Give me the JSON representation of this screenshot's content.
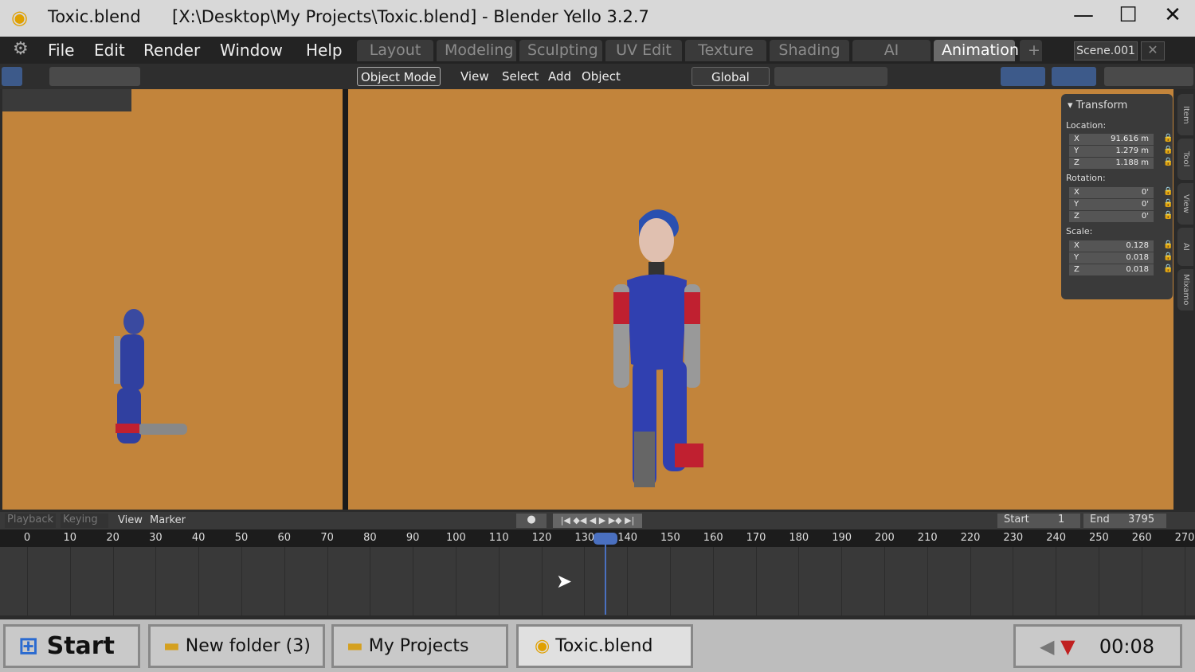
{
  "window": {
    "file": "Toxic.blend",
    "title": "[X:\\Desktop\\My Projects\\Toxic.blend] - Blender Yello 3.2.7",
    "minimize": "—",
    "maximize": "☐",
    "close": "✕"
  },
  "menu": [
    "File",
    "Edit",
    "Render",
    "Window",
    "Help"
  ],
  "workspaces": [
    {
      "label": "Layout"
    },
    {
      "label": "Modeling"
    },
    {
      "label": "Sculpting"
    },
    {
      "label": "UV Edit"
    },
    {
      "label": "Texture"
    },
    {
      "label": "Shading"
    },
    {
      "label": "AI"
    },
    {
      "label": "Animation",
      "active": true
    }
  ],
  "add_workspace": "+",
  "scene": "Scene.001",
  "toolbar": {
    "mode": "Object Mode",
    "view": "View",
    "select": "Select",
    "add": "Add",
    "object": "Object",
    "orientation": "Global"
  },
  "viewport_color": "#c2843b",
  "transform": {
    "title": "Transform",
    "location_label": "Location:",
    "location": [
      {
        "axis": "X",
        "value": "91.616 m"
      },
      {
        "axis": "Y",
        "value": "1.279 m"
      },
      {
        "axis": "Z",
        "value": "1.188 m"
      }
    ],
    "rotation_label": "Rotation:",
    "rotation": [
      {
        "axis": "X",
        "value": "0'"
      },
      {
        "axis": "Y",
        "value": "0'"
      },
      {
        "axis": "Z",
        "value": "0'"
      }
    ],
    "scale_label": "Scale:",
    "scale": [
      {
        "axis": "X",
        "value": "0.128"
      },
      {
        "axis": "Y",
        "value": "0.018"
      },
      {
        "axis": "Z",
        "value": "0.018"
      }
    ]
  },
  "side_tabs": [
    "Item",
    "Tool",
    "View",
    "AI",
    "Mixamo"
  ],
  "timeline": {
    "playback": "Playback",
    "keying": "Keying",
    "view": "View",
    "marker": "Marker",
    "start_label": "Start",
    "start": "1",
    "end_label": "End",
    "end": "3795",
    "current_frame": 135,
    "ticks": [
      "0",
      "10",
      "20",
      "30",
      "40",
      "50",
      "60",
      "70",
      "80",
      "90",
      "100",
      "110",
      "120",
      "130",
      "140",
      "150",
      "160",
      "170",
      "180",
      "190",
      "200",
      "210",
      "220",
      "230",
      "240",
      "250",
      "260",
      "270"
    ]
  },
  "taskbar": {
    "start": "Start",
    "tasks": [
      "New folder (3)",
      "My Projects",
      "Toxic.blend"
    ],
    "clock": "00:08"
  }
}
